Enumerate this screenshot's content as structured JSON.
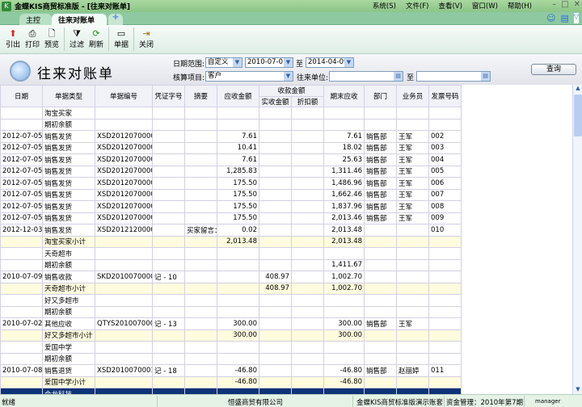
{
  "window": {
    "title": "金蝶KIS商贸标准版 - [往来对账单]",
    "menus": [
      "系统(S)",
      "文件(F)",
      "查看(V)",
      "窗口(W)",
      "帮助(H)"
    ]
  },
  "tabs": [
    {
      "label": "主控台"
    },
    {
      "label": "往来对账单"
    }
  ],
  "toolbar": [
    {
      "label": "引出",
      "icon": "export-icon",
      "glyph": "⬆"
    },
    {
      "label": "打印",
      "icon": "print-icon",
      "glyph": "🖶"
    },
    {
      "label": "预览",
      "icon": "preview-icon",
      "glyph": "🔍"
    },
    {
      "label": "过滤",
      "icon": "filter-icon",
      "glyph": "⧩"
    },
    {
      "label": "刷新",
      "icon": "refresh-icon",
      "glyph": "⟳"
    },
    {
      "label": "单据",
      "icon": "document-icon",
      "glyph": "▭"
    },
    {
      "label": "关闭",
      "icon": "exit-icon",
      "glyph": "⇥"
    }
  ],
  "page_title": "往来对账单",
  "filter": {
    "date_range_label": "日期范围:",
    "date_range": "自定义",
    "date_from": "2010-07-01",
    "to": "至",
    "date_to": "2014-04-09",
    "item_label": "核算项目:",
    "item": "客户",
    "unit_label": "往来单位:",
    "unit_from": "",
    "unit_to": "",
    "query": "查询"
  },
  "columns": {
    "date": "日期",
    "type": "单据类型",
    "no": "单据编号",
    "voucher": "凭证字号",
    "summary": "摘要",
    "receivable": "应收金额",
    "received_group": "收款金额",
    "received": "实收金额",
    "discount": "折扣额",
    "ending": "期末应收",
    "dept": "部门",
    "staff": "业务员",
    "invoice": "发票号码"
  },
  "rows": [
    {
      "kind": "",
      "c": [
        "",
        "淘宝买家",
        "",
        "",
        "",
        "",
        "",
        "",
        "",
        "",
        "",
        ""
      ]
    },
    {
      "kind": "",
      "c": [
        "",
        "期初余额",
        "",
        "",
        "",
        "",
        "",
        "",
        "",
        "",
        "",
        ""
      ]
    },
    {
      "kind": "",
      "c": [
        "2012-07-05",
        "销售发货",
        "XSD20120700001",
        "",
        "",
        "7.61",
        "",
        "",
        "7.61",
        "销售部",
        "王军",
        "002"
      ]
    },
    {
      "kind": "",
      "c": [
        "2012-07-05",
        "销售发货",
        "XSD20120700002",
        "",
        "",
        "10.41",
        "",
        "",
        "18.02",
        "销售部",
        "王军",
        "003"
      ]
    },
    {
      "kind": "",
      "c": [
        "2012-07-05",
        "销售发货",
        "XSD20120700003",
        "",
        "",
        "7.61",
        "",
        "",
        "25.63",
        "销售部",
        "王军",
        "004"
      ]
    },
    {
      "kind": "",
      "c": [
        "2012-07-05",
        "销售发货",
        "XSD20120700004",
        "",
        "",
        "1,285.83",
        "",
        "",
        "1,311.46",
        "销售部",
        "王军",
        "005"
      ]
    },
    {
      "kind": "",
      "c": [
        "2012-07-05",
        "销售发货",
        "XSD20120700005",
        "",
        "",
        "175.50",
        "",
        "",
        "1,486.96",
        "销售部",
        "王军",
        "006"
      ]
    },
    {
      "kind": "",
      "c": [
        "2012-07-05",
        "销售发货",
        "XSD20120700006",
        "",
        "",
        "175.50",
        "",
        "",
        "1,662.46",
        "销售部",
        "王军",
        "007"
      ]
    },
    {
      "kind": "",
      "c": [
        "2012-07-05",
        "销售发货",
        "XSD20120700007",
        "",
        "",
        "175.50",
        "",
        "",
        "1,837.96",
        "销售部",
        "王军",
        "008"
      ]
    },
    {
      "kind": "",
      "c": [
        "2012-07-05",
        "销售发货",
        "XSD20120700008",
        "",
        "",
        "175.50",
        "",
        "",
        "2,013.46",
        "销售部",
        "王军",
        "009"
      ]
    },
    {
      "kind": "",
      "c": [
        "2012-12-03",
        "销售发货",
        "XSD20121200001",
        "",
        "买家留言：",
        "0.02",
        "",
        "",
        "2,013.48",
        "",
        "",
        "010"
      ]
    },
    {
      "kind": "sub",
      "c": [
        "",
        "淘宝买家小计",
        "",
        "",
        "",
        "2,013.48",
        "",
        "",
        "2,013.48",
        "",
        "",
        ""
      ]
    },
    {
      "kind": "",
      "c": [
        "",
        "天奇超市",
        "",
        "",
        "",
        "",
        "",
        "",
        "",
        "",
        "",
        ""
      ]
    },
    {
      "kind": "",
      "c": [
        "",
        "期初余额",
        "",
        "",
        "",
        "",
        "",
        "",
        "1,411.67",
        "",
        "",
        ""
      ]
    },
    {
      "kind": "",
      "c": [
        "2010-07-09",
        "销售收款",
        "SKD20100700006",
        "记 - 10",
        "",
        "",
        "408.97",
        "",
        "1,002.70",
        "",
        "",
        ""
      ]
    },
    {
      "kind": "sub",
      "c": [
        "",
        "天奇超市小计",
        "",
        "",
        "",
        "",
        "408.97",
        "",
        "1,002.70",
        "",
        "",
        ""
      ]
    },
    {
      "kind": "",
      "c": [
        "",
        "好又多超市",
        "",
        "",
        "",
        "",
        "",
        "",
        "",
        "",
        "",
        ""
      ]
    },
    {
      "kind": "",
      "c": [
        "",
        "期初余额",
        "",
        "",
        "",
        "",
        "",
        "",
        "",
        "",
        "",
        ""
      ]
    },
    {
      "kind": "",
      "c": [
        "2010-07-02",
        "其他应收",
        "QTYS20100700004",
        "记 - 13",
        "",
        "300.00",
        "",
        "",
        "300.00",
        "销售部",
        "王军",
        ""
      ]
    },
    {
      "kind": "sub",
      "c": [
        "",
        "好又多超市小计",
        "",
        "",
        "",
        "300.00",
        "",
        "",
        "300.00",
        "",
        "",
        ""
      ]
    },
    {
      "kind": "",
      "c": [
        "",
        "爱国中学",
        "",
        "",
        "",
        "",
        "",
        "",
        "",
        "",
        "",
        ""
      ]
    },
    {
      "kind": "",
      "c": [
        "",
        "期初余额",
        "",
        "",
        "",
        "",
        "",
        "",
        "",
        "",
        "",
        ""
      ]
    },
    {
      "kind": "",
      "c": [
        "2010-07-08",
        "销售退货",
        "XSD20100700014",
        "记 - 18",
        "",
        "-46.80",
        "",
        "",
        "-46.80",
        "销售部",
        "赵丽婷",
        "011"
      ]
    },
    {
      "kind": "sub",
      "c": [
        "",
        "爱国中学小计",
        "",
        "",
        "",
        "-46.80",
        "",
        "",
        "-46.80",
        "",
        "",
        ""
      ]
    },
    {
      "kind": "sel",
      "c": [
        "",
        "合龙科技",
        "",
        "",
        "",
        "",
        "",
        "",
        "",
        "",
        "",
        ""
      ]
    }
  ],
  "status": {
    "ready": "就绪",
    "company": "恒盛商贸有限公司",
    "account": "金蝶KIS商贸标准版演示账套",
    "period": "资金管理：2010年第7期",
    "user": "manager"
  }
}
